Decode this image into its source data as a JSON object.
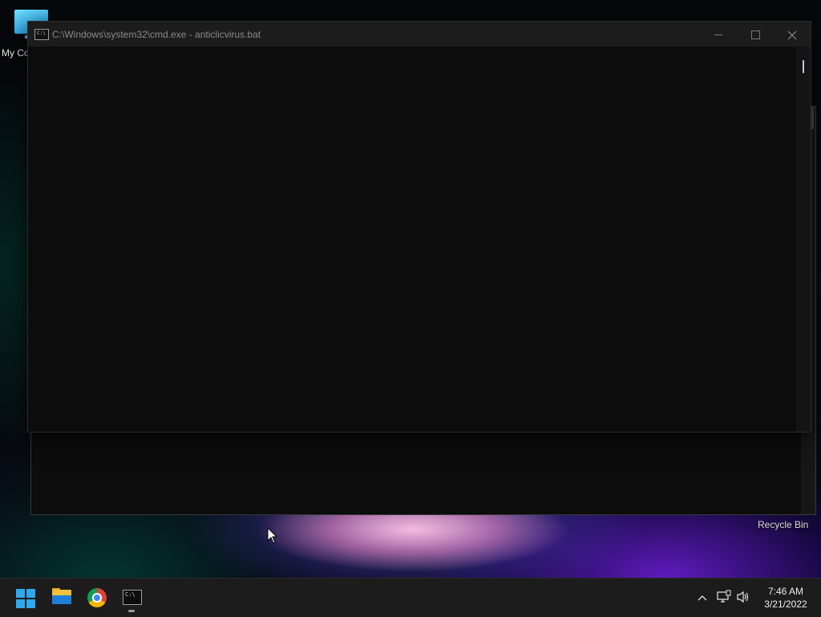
{
  "desktop": {
    "icons": [
      {
        "label": "My Co"
      },
      {
        "label": "Recycle Bin"
      }
    ]
  },
  "cmd_window": {
    "title": "C:\\Windows\\system32\\cmd.exe - anticlicvirus.bat",
    "icon_text": "C:\\",
    "console_text": ""
  },
  "taskbar": {
    "apps": [
      {
        "name": "Start",
        "icon": "windows-logo-icon"
      },
      {
        "name": "File Explorer",
        "icon": "folder-icon"
      },
      {
        "name": "Google Chrome",
        "icon": "chrome-icon"
      },
      {
        "name": "Command Prompt",
        "icon": "terminal-icon",
        "running": true
      }
    ],
    "tray": {
      "chevron": "^",
      "time": "7:46 AM",
      "date": "3/21/2022"
    }
  },
  "colors": {
    "accent": "#2fa8f0",
    "console_bg": "#0c0c0c",
    "titlebar_bg": "#1c1c1c",
    "taskbar_bg": "#1c1c1c"
  }
}
